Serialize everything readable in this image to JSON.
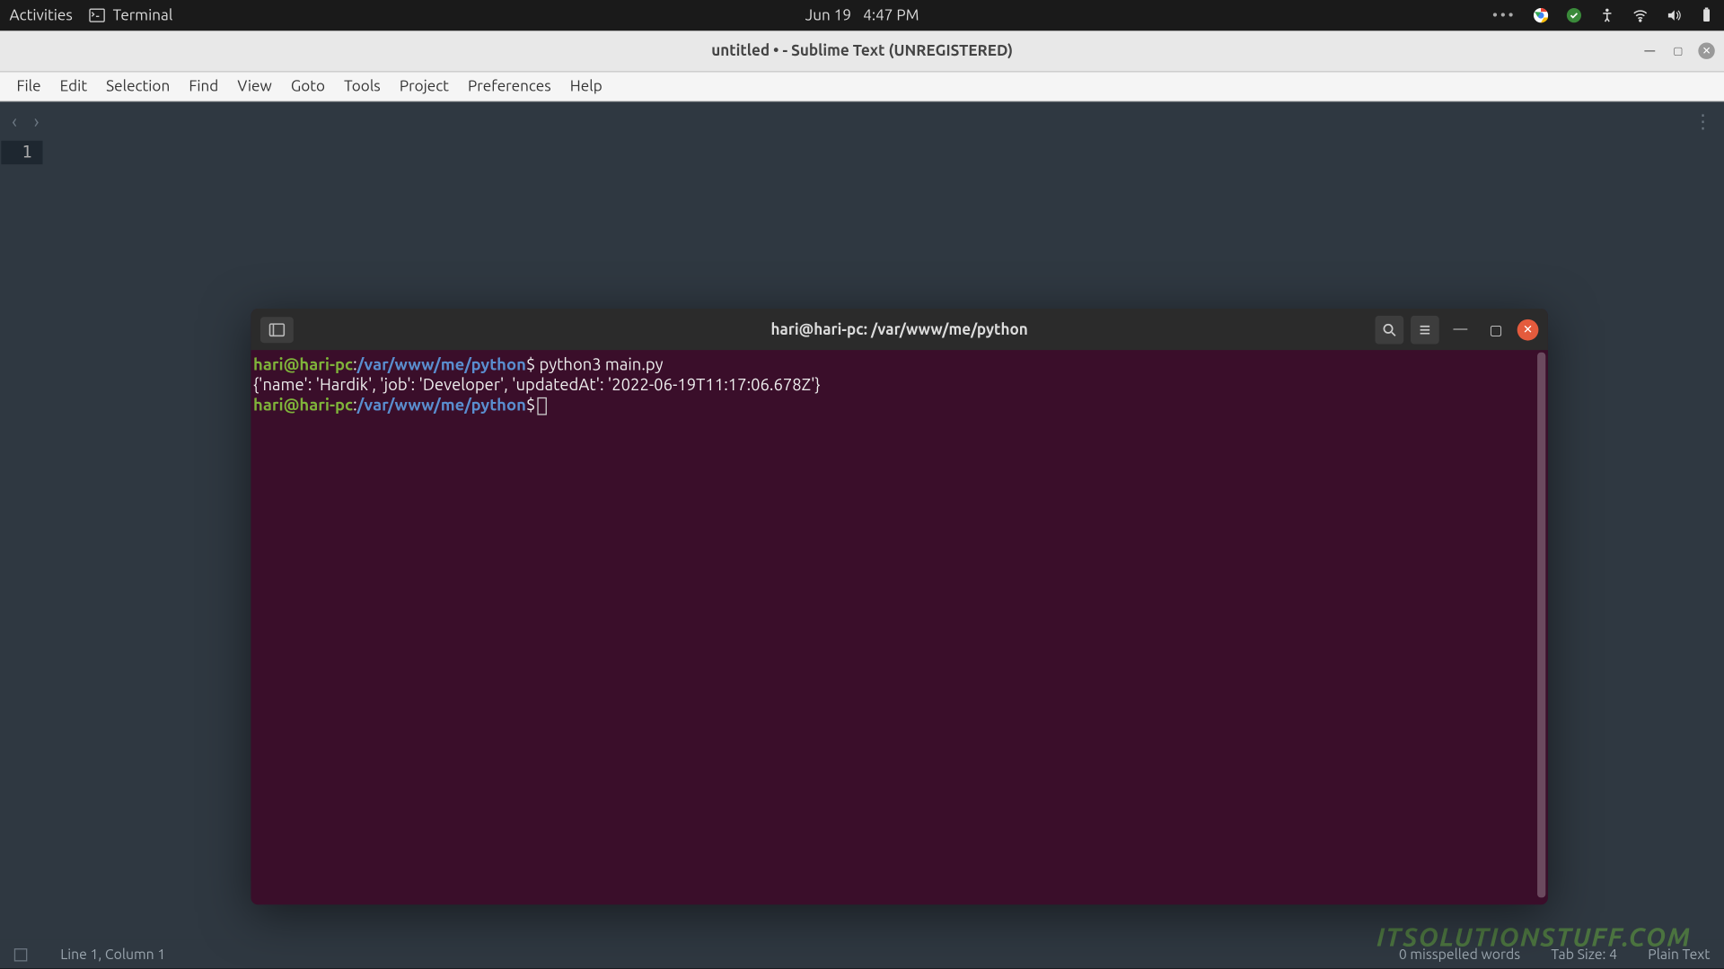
{
  "topbar": {
    "activities": "Activities",
    "terminal": "Terminal",
    "date": "Jun 19",
    "time": "4:47 PM"
  },
  "sublime": {
    "title": "untitled • - Sublime Text (UNREGISTERED)",
    "menu": [
      "File",
      "Edit",
      "Selection",
      "Find",
      "View",
      "Goto",
      "Tools",
      "Project",
      "Preferences",
      "Help"
    ],
    "line_number": "1",
    "status_left": "Line 1, Column 1",
    "status_spell": "0 misspelled words",
    "status_tab": "Tab Size: 4",
    "status_syntax": "Plain Text"
  },
  "terminal": {
    "title": "hari@hari-pc: /var/www/me/python",
    "prompt_user": "hari@hari-pc",
    "prompt_sep": ":",
    "prompt_path": "/var/www/me/python",
    "prompt_sym": "$",
    "cmd1": " python3 main.py",
    "output": "{'name': 'Hardik', 'job': 'Developer', 'updatedAt': '2022-06-19T11:17:06.678Z'}"
  },
  "watermark": "ITSOLUTIONSTUFF.COM"
}
